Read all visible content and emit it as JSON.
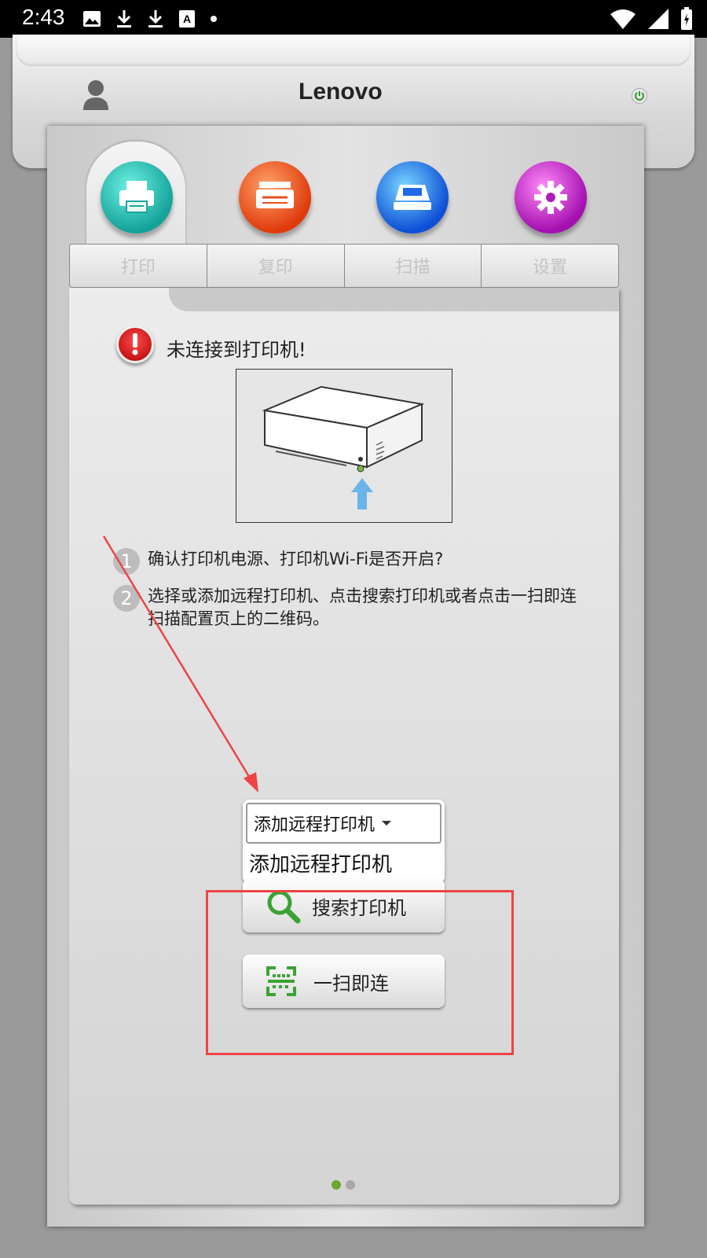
{
  "status_bar": {
    "time": "2:43",
    "left_icons": [
      "image-icon",
      "download-icon",
      "download-icon",
      "font-icon",
      "dot-icon"
    ],
    "right_icons": [
      "wifi-icon",
      "signal-icon",
      "battery-icon"
    ]
  },
  "header": {
    "brand": "Lenovo",
    "power_color": "#2a9d2a"
  },
  "tabs": [
    {
      "label": "打印",
      "icon": "printer-icon",
      "color": "#1fb7b0",
      "active": true
    },
    {
      "label": "复印",
      "icon": "copier-icon",
      "color": "#f24b15",
      "active": false
    },
    {
      "label": "扫描",
      "icon": "scanner-icon",
      "color": "#1a6cf0",
      "active": false
    },
    {
      "label": "设置",
      "icon": "gear-icon",
      "color": "#c21bc9",
      "active": false
    }
  ],
  "content": {
    "alert": "未连接到打印机!",
    "steps": [
      {
        "num": "1",
        "text": "确认打印机电源、打印机Wi-Fi是否开启?"
      },
      {
        "num": "2",
        "text": "选择或添加远程打印机、点击搜索打印机或者点击一扫即连扫描配置页上的二维码。"
      }
    ],
    "dropdown": {
      "selected": "添加远程打印机",
      "option": "添加远程打印机"
    },
    "search_button": "搜索打印机",
    "scan_button": "一扫即连"
  },
  "pager": {
    "count": 2,
    "active": 0,
    "active_color": "#6aa832",
    "inactive_color": "#a8a8a8"
  }
}
